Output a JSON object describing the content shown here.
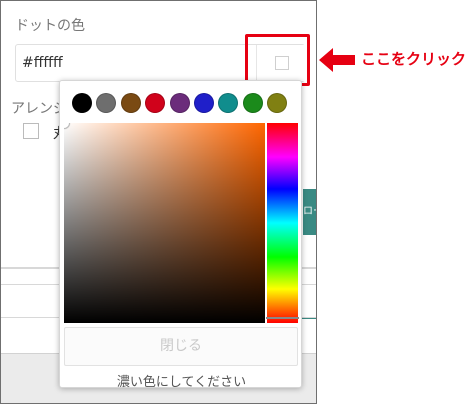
{
  "settings": {
    "dot_color_label": "ドットの色",
    "hex_value": "#ffffff",
    "arrange_label": "アレンジ",
    "arrange_option_partial": "丸",
    "side_button_partial": "ロー"
  },
  "annotation": {
    "note": "ここをクリック",
    "color": "#e60012"
  },
  "picker": {
    "presets": [
      "#000000",
      "#6e6e6e",
      "#7a4a13",
      "#d0021b",
      "#6b2c7b",
      "#1f1fc9",
      "#108d8d",
      "#1b8a1b",
      "#808012"
    ],
    "current_hue": "#ff6600",
    "hue_position": 0.975,
    "close_label": "閉じる",
    "hint": "濃い色にしてください"
  }
}
